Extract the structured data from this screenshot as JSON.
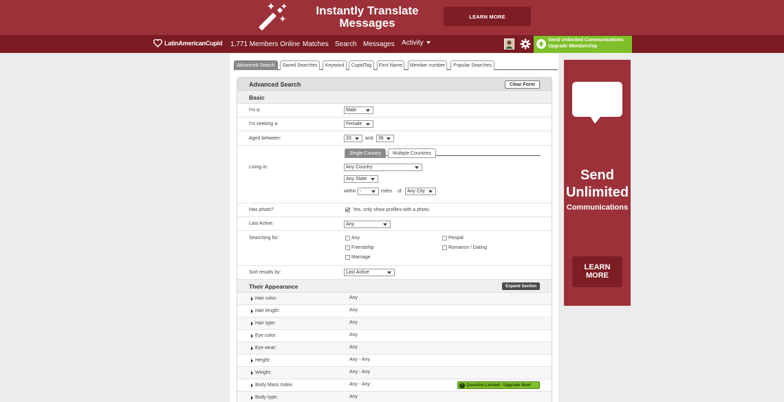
{
  "banner": {
    "headline_line1": "Instantly Translate",
    "headline_line2": "Messages",
    "cta": "LEARN MORE"
  },
  "nav": {
    "logo": "LatinAmericanCupid",
    "members_online": "1,771 Members Online",
    "matches": "Matches",
    "search": "Search",
    "messages": "Messages",
    "activity": "Activity",
    "upgrade_line1": "Send Unlimited Communications",
    "upgrade_line2": "Upgrade Membership"
  },
  "tabs": [
    "Advanced Search",
    "Saved Searches",
    "Keyword",
    "CupidTag",
    "First Name",
    "Member number",
    "Popular Searches"
  ],
  "form": {
    "title": "Advanced Search",
    "clear_button": "Clear Form",
    "basic_title": "Basic",
    "im_a_label": "I'm a:",
    "im_a_value": "Male",
    "seeking_label": "I'm seeking a:",
    "seeking_value": "Female",
    "aged_label": "Aged between:",
    "age_min": "20",
    "age_and": "and",
    "age_max": "36",
    "living_label": "Living in:",
    "single_country_tab": "Single Country",
    "multiple_countries_tab": "Multiple Countries",
    "country_value": "Any Country",
    "state_value": "Any State",
    "within_label": "within",
    "miles_value": "-",
    "miles_label": "miles",
    "of_label": "of",
    "city_value": "Any City",
    "photo_label": "Has photo?",
    "photo_option": "Yes, only show profiles with a photo.",
    "last_active_label": "Last Active:",
    "last_active_value": "Any",
    "searching_label": "Searching for:",
    "searching_options": [
      "Any",
      "Friendship",
      "Marriage",
      "Penpal",
      "Romance / Dating"
    ],
    "sort_label": "Sort results by:",
    "sort_value": "Last Active"
  },
  "appearance": {
    "title": "Their Appearance",
    "expand_button": "Expand Section",
    "locked_label": "Question Locked - Upgrade Now!",
    "rows": [
      {
        "name": "Hair color:",
        "value": "Any"
      },
      {
        "name": "Hair length:",
        "value": "Any"
      },
      {
        "name": "Hair type:",
        "value": "Any"
      },
      {
        "name": "Eye color:",
        "value": "Any"
      },
      {
        "name": "Eye wear:",
        "value": "Any"
      },
      {
        "name": "Height:",
        "value": "Any - Any"
      },
      {
        "name": "Weight:",
        "value": "Any - Any"
      },
      {
        "name": "Body Mass Index:",
        "value": "Any - Any"
      },
      {
        "name": "Body type:",
        "value": "Any"
      }
    ]
  },
  "side_ad": {
    "line1": "Send",
    "line2": "Unlimited",
    "line3": "Communications",
    "cta_line1": "LEARN",
    "cta_line2": "MORE"
  },
  "colors": {
    "brand_red": "#9c3139",
    "nav_red": "#7a1c22",
    "upgrade_green": "#7fbf2a"
  }
}
